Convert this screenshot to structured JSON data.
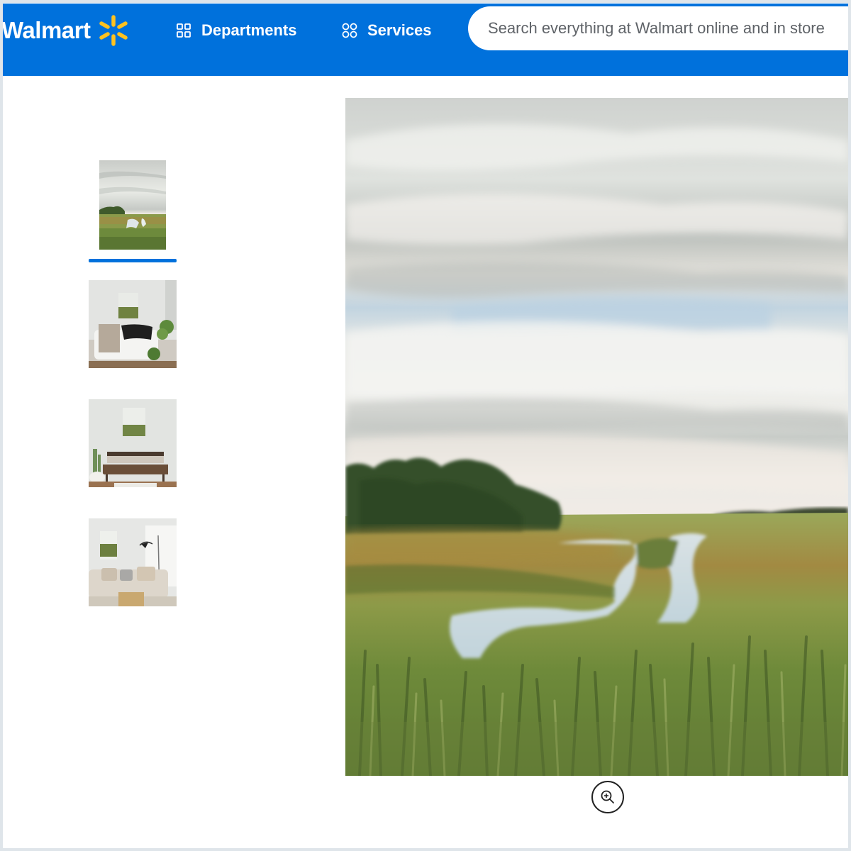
{
  "header": {
    "logo_text": "Walmart",
    "logo_icon": "spark-icon",
    "brand_color": "#0071dc",
    "spark_color": "#ffc220",
    "nav": [
      {
        "label": "Departments",
        "icon": "grid-icon"
      },
      {
        "label": "Services",
        "icon": "circles-grid-icon"
      }
    ],
    "search": {
      "placeholder": "Search everything at Walmart online and in store",
      "value": ""
    }
  },
  "gallery": {
    "selected_index": 0,
    "thumbnails": [
      {
        "alt": "Marsh landscape painting",
        "selected": true
      },
      {
        "alt": "Painting above white sofa in living room",
        "selected": false
      },
      {
        "alt": "Painting above wooden bench",
        "selected": false
      },
      {
        "alt": "Painting beside floor lamp and beige sofa",
        "selected": false
      }
    ],
    "main_image_alt": "Marsh landscape painting with cloudy sky, trees and winding creek",
    "zoom_icon": "zoom-in-icon"
  }
}
